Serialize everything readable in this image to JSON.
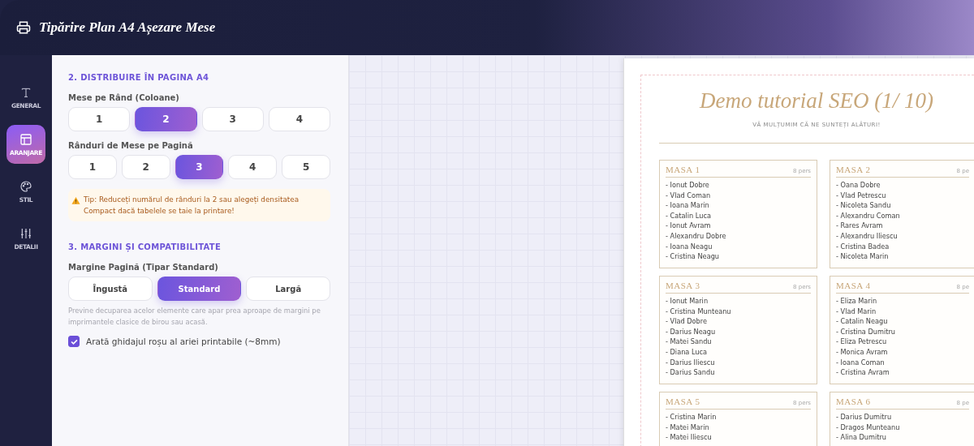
{
  "header": {
    "title": "Tipărire Plan A4 Așezare Mese"
  },
  "sidebar": {
    "items": [
      {
        "label": "GENERAL",
        "kind": "text",
        "selected": false
      },
      {
        "label": "ARANJARE",
        "kind": "layout",
        "selected": true
      },
      {
        "label": "STIL",
        "kind": "palette",
        "selected": false
      },
      {
        "label": "DETALII",
        "kind": "sliders",
        "selected": false
      }
    ]
  },
  "settings": {
    "distribution": {
      "title": "2. DISTRIBUIRE ÎN PAGINA A4",
      "columns": {
        "label": "Mese pe Rând (Coloane)",
        "options": [
          {
            "label": "1",
            "selected": false
          },
          {
            "label": "2",
            "selected": true
          },
          {
            "label": "3",
            "selected": false
          },
          {
            "label": "4",
            "selected": false
          }
        ]
      },
      "rows": {
        "label": "Rânduri de Mese pe Pagină",
        "options": [
          {
            "label": "1",
            "selected": false
          },
          {
            "label": "2",
            "selected": false
          },
          {
            "label": "3",
            "selected": true
          },
          {
            "label": "4",
            "selected": false
          },
          {
            "label": "5",
            "selected": false
          }
        ]
      },
      "tip": "Tip: Reduceți numărul de rânduri la 2 sau alegeți densitatea Compact dacă tabelele se taie la printare!"
    },
    "margins": {
      "title": "3. MARGINI ȘI COMPATIBILITATE",
      "label": "Margine Pagină (Tipar Standard)",
      "options": [
        {
          "label": "Îngustă",
          "selected": false
        },
        {
          "label": "Standard",
          "selected": true
        },
        {
          "label": "Largă",
          "selected": false
        }
      ],
      "hint": "Previne decuparea acelor elemente care apar prea aproape de margini pe imprimantele clasice de birou sau acasă.",
      "guide": {
        "label": "Arată ghidajul roșu al ariei printabile (~8mm)",
        "checked": true
      }
    }
  },
  "preview": {
    "title": "Demo tutorial SEO (1/ 10)",
    "subtitle": "VĂ MULȚUMIM CĂ NE SUNTEȚI ALĂTURI!",
    "tables": [
      {
        "name": "MASA 1",
        "count": "8 pers",
        "guests": [
          "- Ionut Dobre",
          "- Vlad Coman",
          "- Ioana Marin",
          "- Catalin Luca",
          "- Ionut Avram",
          "- Alexandru Dobre",
          "- Ioana Neagu",
          "- Cristina Neagu"
        ]
      },
      {
        "name": "MASA 2",
        "count": "8 pe",
        "guests": [
          "- Oana Dobre",
          "- Vlad Petrescu",
          "- Nicoleta Sandu",
          "- Alexandru Coman",
          "- Rares Avram",
          "- Alexandru Iliescu",
          "- Cristina Badea",
          "- Nicoleta Marin"
        ]
      },
      {
        "name": "MASA 3",
        "count": "8 pers",
        "guests": [
          "- Ionut Marin",
          "- Cristina Munteanu",
          "- Vlad Dobre",
          "- Darius Neagu",
          "- Matei Sandu",
          "- Diana Luca",
          "- Darius Iliescu",
          "- Darius Sandu"
        ]
      },
      {
        "name": "MASA 4",
        "count": "8 pe",
        "guests": [
          "- Eliza Marin",
          "- Vlad Marin",
          "- Catalin Neagu",
          "- Cristina Dumitru",
          "- Eliza Petrescu",
          "- Monica Avram",
          "- Ioana Coman",
          "- Cristina Avram"
        ]
      },
      {
        "name": "MASA 5",
        "count": "8 pers",
        "guests": [
          "- Cristina Marin",
          "- Matei Marin",
          "- Matei Iliescu"
        ]
      },
      {
        "name": "MASA 6",
        "count": "8 pe",
        "guests": [
          "- Darius Dumitru",
          "- Dragos Munteanu",
          "- Alina Dumitru"
        ]
      }
    ]
  }
}
